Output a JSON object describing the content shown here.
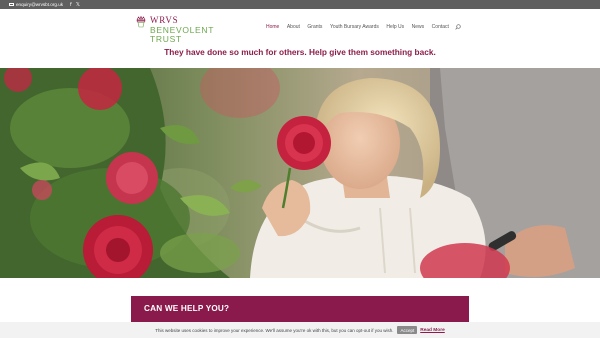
{
  "topbar": {
    "email": "enquiry@wrvsbt.org.uk",
    "social": [
      {
        "icon": "facebook-icon",
        "glyph": "f"
      },
      {
        "icon": "x-icon",
        "glyph": "𝕏"
      }
    ]
  },
  "logo": {
    "line1": "WRVS",
    "line2": "BENEVOLENT",
    "line3": "TRUST",
    "colors": {
      "wrvs": "#8c1d4a",
      "trust": "#6da84d"
    }
  },
  "nav": {
    "items": [
      "Home",
      "About",
      "Grants",
      "Youth Bursary Awards",
      "Help Us",
      "News",
      "Contact"
    ],
    "active": "Home"
  },
  "tagline": "They have done so much for others. Help give them something back.",
  "hero": {
    "description_icon": "hero-photo"
  },
  "help_section": {
    "title": "CAN WE HELP YOU?"
  },
  "cookie_bar": {
    "message": "This website uses cookies to improve your experience. We'll assume you're ok with this, but you can opt-out if you wish.",
    "accept_label": "Accept",
    "more_label": "Read More"
  },
  "colors": {
    "brand": "#8c1d4a",
    "topbar": "#5f5f5f"
  }
}
